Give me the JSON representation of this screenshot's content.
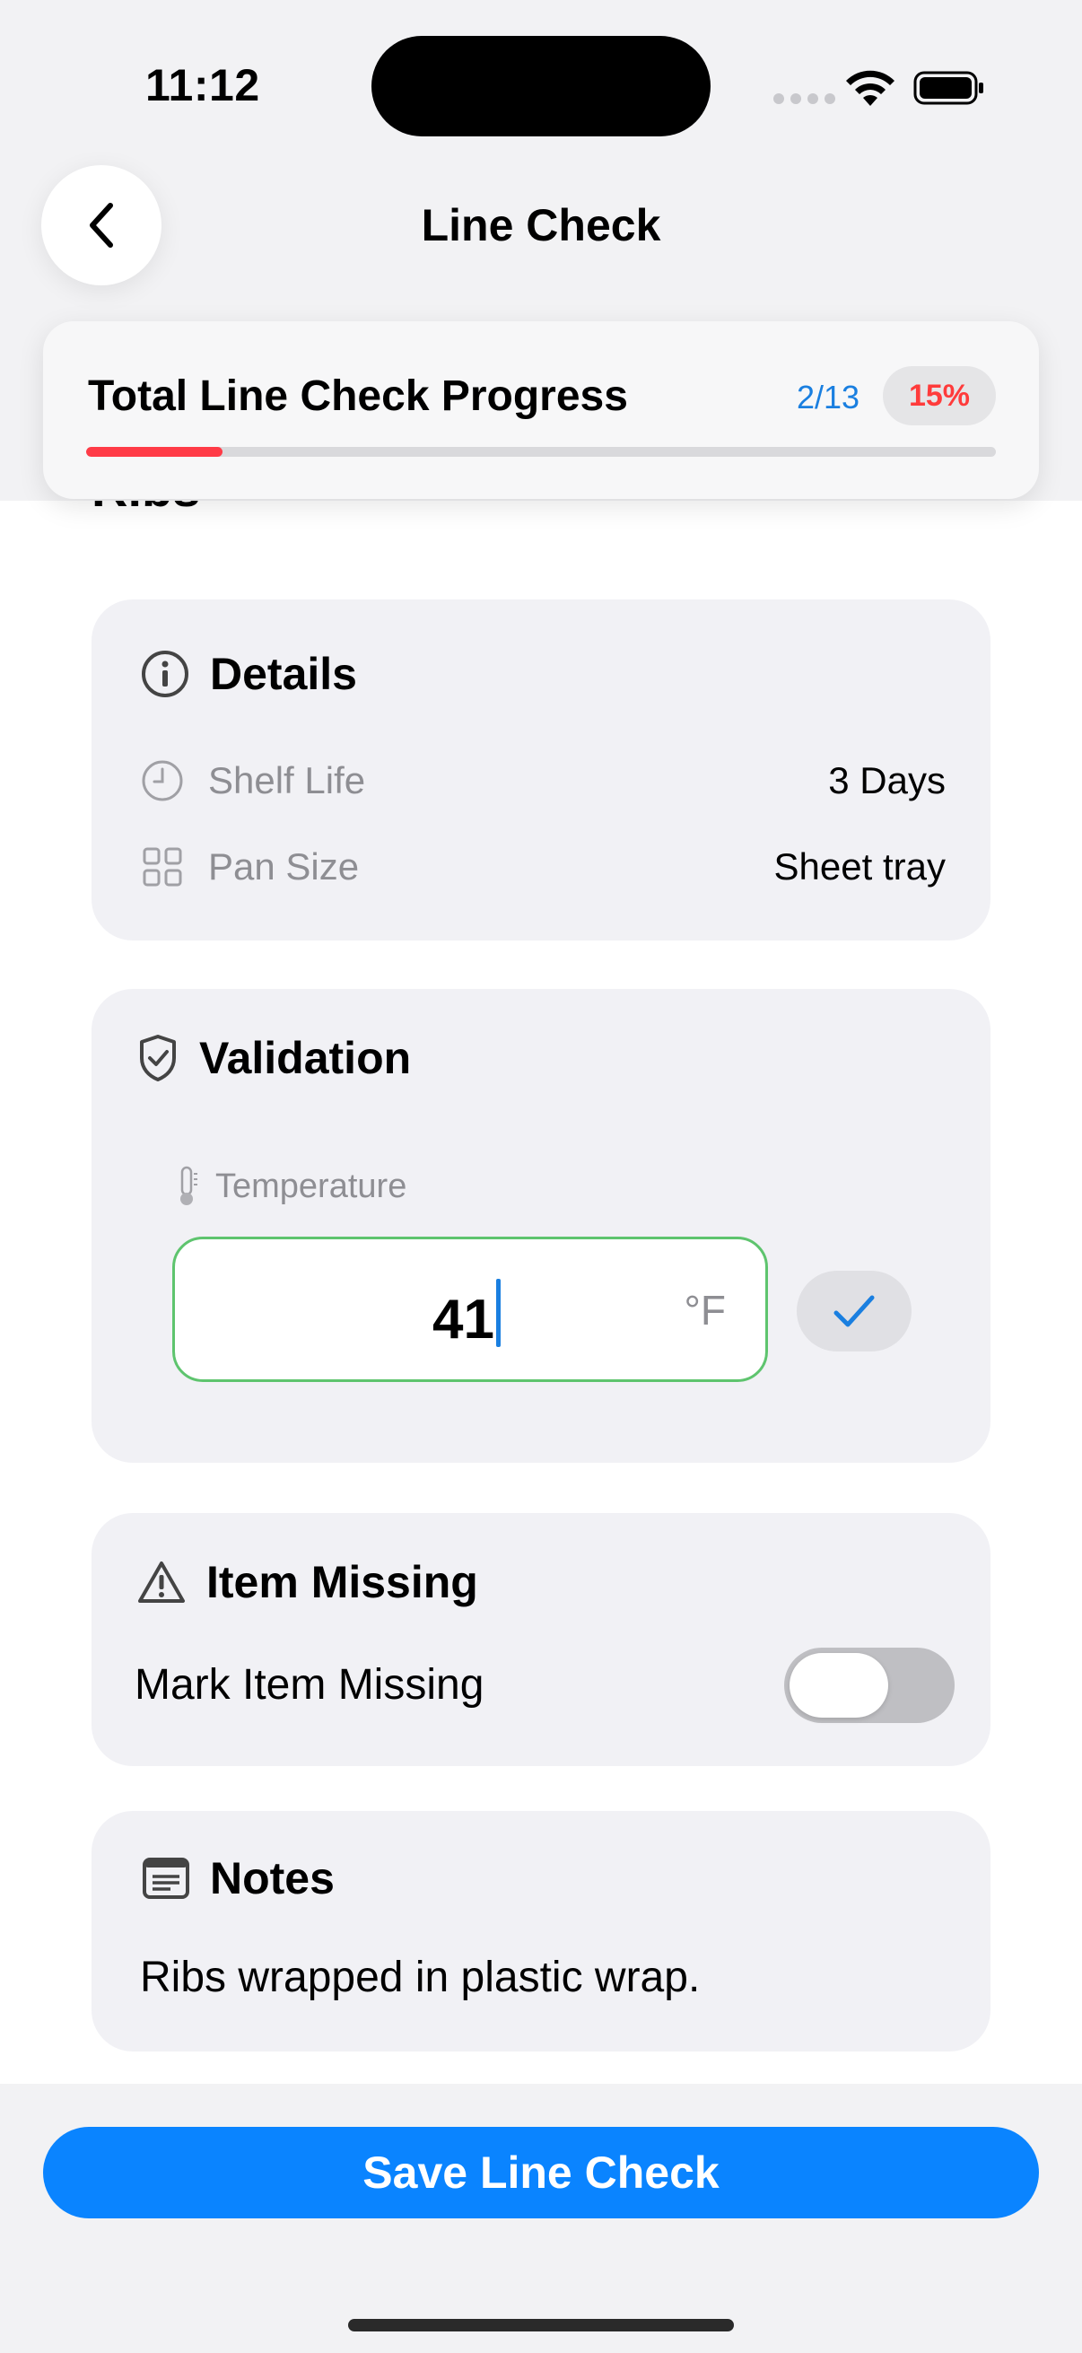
{
  "status_bar": {
    "time": "11:12"
  },
  "nav": {
    "title": "Line Check",
    "back_icon": "chevron-left-icon"
  },
  "progress": {
    "title": "Total Line Check Progress",
    "count": "2/13",
    "percent_label": "15%",
    "fraction": 0.15,
    "fill_color": "#ff3b47"
  },
  "item": {
    "title": "Ribs"
  },
  "details": {
    "header": "Details",
    "icon": "info-circle-icon",
    "rows": [
      {
        "icon": "clock-icon",
        "label": "Shelf Life",
        "value": "3 Days"
      },
      {
        "icon": "grid-icon",
        "label": "Pan Size",
        "value": "Sheet tray"
      }
    ]
  },
  "validation": {
    "header": "Validation",
    "icon": "shield-check-icon",
    "temp_label": "Temperature",
    "temp_icon": "thermometer-icon",
    "temp_value": "41",
    "temp_unit": "°F",
    "input_border_color": "#5ec46e",
    "confirm_icon": "checkmark-icon"
  },
  "missing": {
    "header": "Item Missing",
    "icon": "warning-triangle-icon",
    "toggle_label": "Mark Item Missing",
    "toggle_on": false
  },
  "notes": {
    "header": "Notes",
    "icon": "note-icon",
    "text": "Ribs wrapped in plastic wrap."
  },
  "footer": {
    "save_label": "Save Line Check",
    "accent": "#0a84ff"
  }
}
